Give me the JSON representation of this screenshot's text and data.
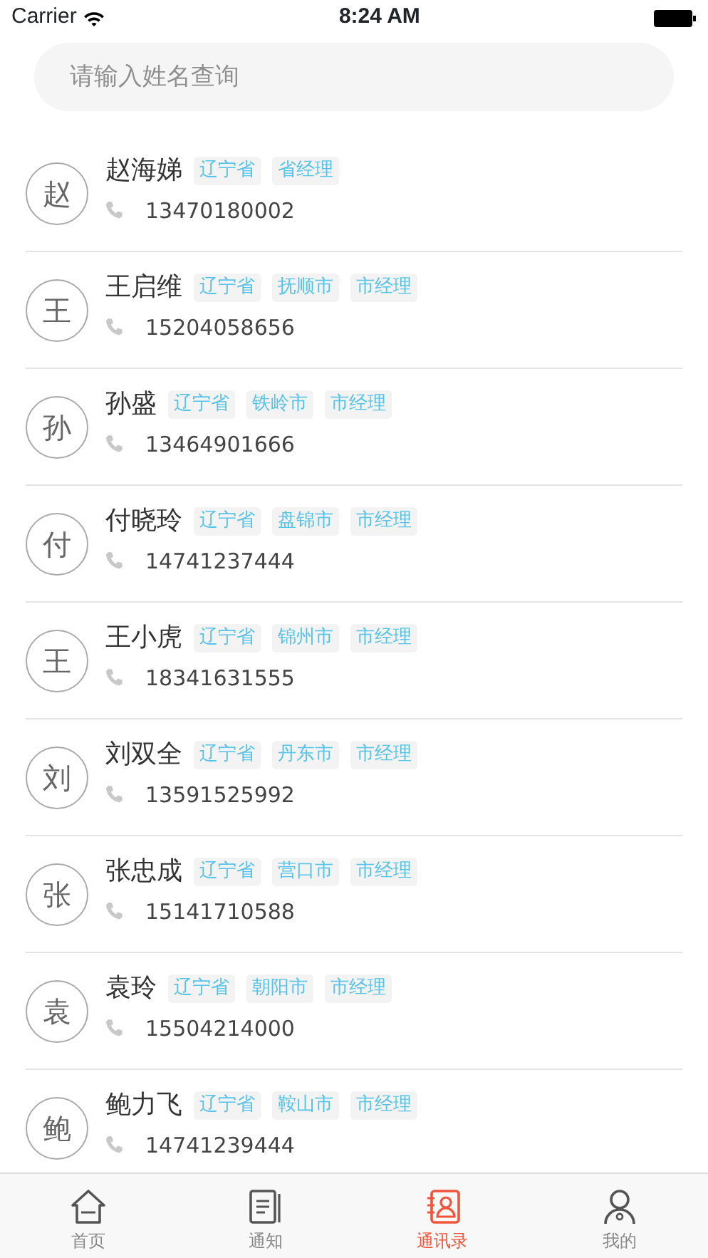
{
  "status_bar": {
    "carrier": "Carrier",
    "time": "8:24 AM"
  },
  "search": {
    "placeholder": "请输入姓名查询"
  },
  "contacts": [
    {
      "avatar": "赵",
      "name": "赵海娣",
      "tags": [
        "辽宁省",
        "省经理"
      ],
      "phone": "13470180002"
    },
    {
      "avatar": "王",
      "name": "王启维",
      "tags": [
        "辽宁省",
        "抚顺市",
        "市经理"
      ],
      "phone": "15204058656"
    },
    {
      "avatar": "孙",
      "name": "孙盛",
      "tags": [
        "辽宁省",
        "铁岭市",
        "市经理"
      ],
      "phone": "13464901666"
    },
    {
      "avatar": "付",
      "name": "付晓玲",
      "tags": [
        "辽宁省",
        "盘锦市",
        "市经理"
      ],
      "phone": "14741237444"
    },
    {
      "avatar": "王",
      "name": "王小虎",
      "tags": [
        "辽宁省",
        "锦州市",
        "市经理"
      ],
      "phone": "18341631555"
    },
    {
      "avatar": "刘",
      "name": "刘双全",
      "tags": [
        "辽宁省",
        "丹东市",
        "市经理"
      ],
      "phone": "13591525992"
    },
    {
      "avatar": "张",
      "name": "张忠成",
      "tags": [
        "辽宁省",
        "营口市",
        "市经理"
      ],
      "phone": "15141710588"
    },
    {
      "avatar": "袁",
      "name": "袁玲",
      "tags": [
        "辽宁省",
        "朝阳市",
        "市经理"
      ],
      "phone": "15504214000"
    },
    {
      "avatar": "鲍",
      "name": "鲍力飞",
      "tags": [
        "辽宁省",
        "鞍山市",
        "市经理"
      ],
      "phone": "14741239444"
    }
  ],
  "tab_bar": [
    {
      "kind": "home",
      "label": "首页",
      "selected": false
    },
    {
      "kind": "notice",
      "label": "通知",
      "selected": false
    },
    {
      "kind": "contacts",
      "label": "通讯录",
      "selected": true
    },
    {
      "kind": "me",
      "label": "我的",
      "selected": false
    }
  ]
}
